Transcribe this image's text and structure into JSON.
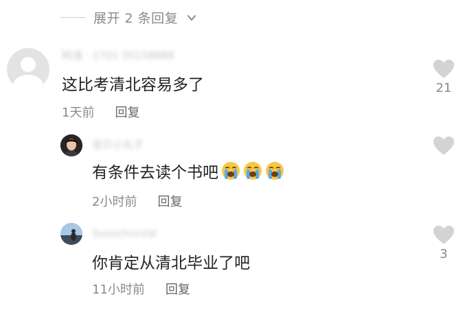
{
  "expand": {
    "label": "展开 2 条回复"
  },
  "comments": [
    {
      "username": "阿涛 · 1701·30158888",
      "text": "这比考清北容易多了",
      "time": "1天前",
      "reply_label": "回复",
      "likes": "21"
    },
    {
      "username": "宝贝小丸子",
      "text": "有条件去读个书吧",
      "time": "2小时前",
      "reply_label": "回复",
      "likes": ""
    },
    {
      "username": "Susuchunzal",
      "text": "你肯定从清北毕业了吧",
      "time": "11小时前",
      "reply_label": "回复",
      "likes": "3"
    }
  ],
  "icons": {
    "heart": "heart-icon",
    "chevron": "chevron-down-icon",
    "emoji": "loudly-crying-face-emoji"
  },
  "colors": {
    "heart": "#d3d3d3",
    "meta_text": "#8a8a8a",
    "body_text": "#222222",
    "emoji_face": "#f7c748",
    "emoji_tear": "#5aa8e6"
  }
}
